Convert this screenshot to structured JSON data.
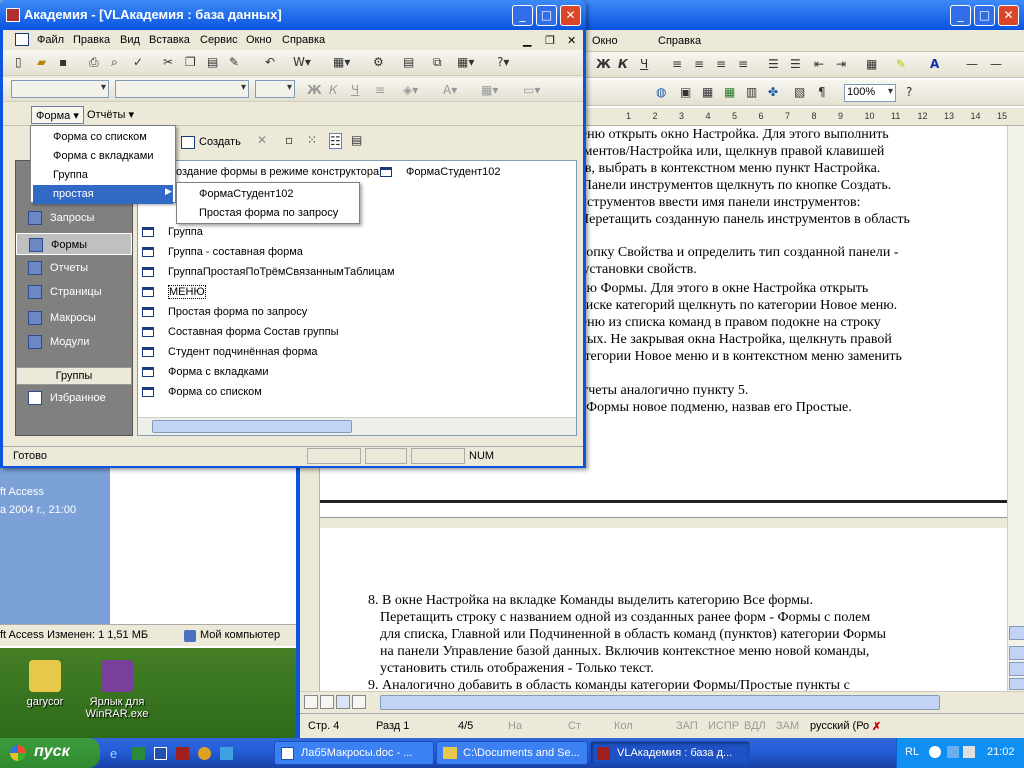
{
  "access": {
    "title": "Академия - [VLАкадемия : база данных]",
    "menu": [
      "Файл",
      "Правка",
      "Вид",
      "Вставка",
      "Сервис",
      "Окно",
      "Справка"
    ],
    "formbar": {
      "form_btn": "Форма ▾",
      "reports_btn": "Отчёты ▾"
    },
    "create_label": "Создать",
    "form_menu": [
      "Форма со списком",
      "Форма с вкладками",
      "Группа",
      "простая"
    ],
    "submenu": [
      "ФормаСтудент102",
      "Простая форма по запросу"
    ],
    "nav": {
      "items": [
        "Запросы",
        "Формы",
        "Отчеты",
        "Страницы",
        "Макросы",
        "Модули"
      ],
      "groups_label": "Группы",
      "favorites": "Избранное"
    },
    "list": [
      "Создание формы в режиме конструктора",
      "ФормаСтудент102",
      "Группа",
      "Группа - составная форма",
      "ГруппаПростаяПоТрёмСвязаннымТаблицам",
      "МЕНЮ",
      "Простая форма по запросу",
      "Составная форма Состав группы",
      "Студент подчинённая форма",
      "Форма с вкладками",
      "Форма со списком"
    ],
    "status": {
      "left": "Готово",
      "num": "NUM"
    }
  },
  "word": {
    "menu": [
      "Справка"
    ],
    "zoom": "100%",
    "ruler": [
      "1",
      "2",
      "3",
      "4",
      "5",
      "6",
      "7",
      "8",
      "9",
      "10",
      "11",
      "12",
      "13",
      "14",
      "15",
      "16"
    ],
    "status": {
      "page": "Стр. 4",
      "section": "Разд 1",
      "pages": "4/5",
      "at": "На",
      "ln": "Ст",
      "col": "Кол",
      "rec": "ЗАП",
      "trk": "ИСПР",
      "ext": "ВДЛ",
      "ovr": "ЗАМ",
      "lang": "русский (Ро"
    },
    "lines_top": [
      "меню открыть окно Настройка. Для этого выполнить",
      "нструментов/Настройка или, щелкнув правой клавишей",
      "тов, выбрать в контекстном меню пункт Настройка.",
      "е Панели инструментов щелкнуть по кнопке Создать.",
      "инструментов ввести имя панели инструментов:",
      ". Перетащить созданную панель инструментов в область",
      "кнопку Свойства и определить тип созданной панели -",
      "о установки свойств.",
      "рию Формы. Для этого в окне Настройка открыть",
      "списке категорий щелкнуть по категории Новое меню.",
      "меню из списка команд в правом подокне на строку",
      "нных. Не закрывая окна Настройка, щелкнуть правой",
      "категории Новое меню и в контекстном меню заменить",
      "Отчеты аналогично пункту 5.",
      "ю Формы новое подменю, назвав его Простые."
    ],
    "lines_bottom": [
      "8. В окне Настройка на вкладке Команды выделить категорию Все формы.",
      "Перетащить строку с названием одной из созданных ранее форм - Формы с полем",
      "для списка, Главной или Подчиненной в область команд (пунктов) категории Формы",
      "на панели Управление базой данных. Включив контекстное меню новой команды,",
      "установить стиль отображения - Только текст.",
      "9. Аналогично добавить в область команды категории Формы/Простые пункты с"
    ]
  },
  "desktop": {
    "bg_text": [
      "ft Access",
      "а 2004 г., 21:00"
    ],
    "explorer_status": [
      "ft Access Изменен: 1 1,51 МБ",
      "Мой компьютер"
    ],
    "icons": [
      "garycor",
      "Ярлык для WinRAR.exe"
    ]
  },
  "taskbar": {
    "start": "пуск",
    "tasks": [
      "Лаб5Макросы.doc - ...",
      "C:\\Documents and Se...",
      "VLАкадемия : база д..."
    ],
    "lang": "RL",
    "clock": "21:02"
  }
}
